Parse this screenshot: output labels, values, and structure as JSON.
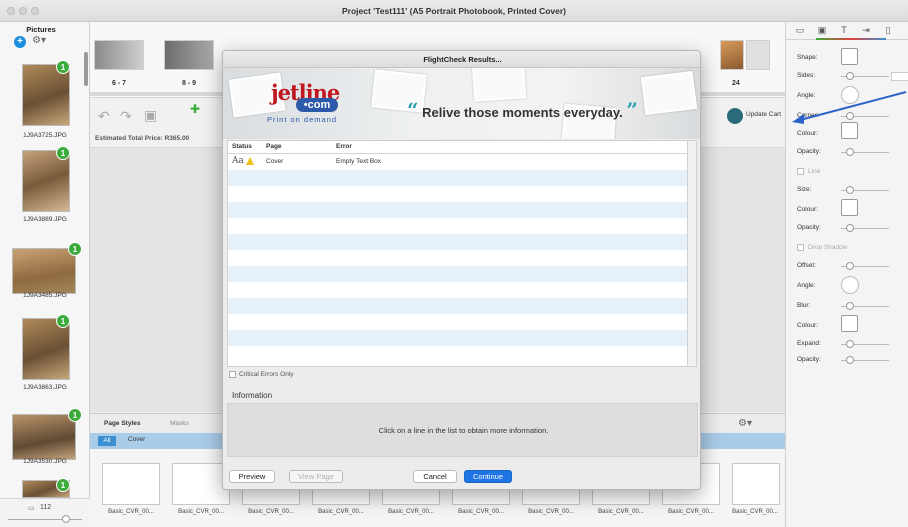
{
  "window": {
    "title": "Project 'Test111' (A5 Portrait Photobook, Printed Cover)"
  },
  "pictures_panel": {
    "title": "Pictures",
    "photos": [
      {
        "filename": "1J9A3725.JPG",
        "count": "1"
      },
      {
        "filename": "1J9A3889.JPG",
        "count": "1"
      },
      {
        "filename": "1J9A3485.JPG",
        "count": "1"
      },
      {
        "filename": "1J9A3863.JPG",
        "count": "1"
      },
      {
        "filename": "1J9A3530.JPG",
        "count": "1"
      },
      {
        "filename": "",
        "count": "1"
      }
    ],
    "footer_count": "112"
  },
  "page_strip": {
    "labels": [
      "6 - 7",
      "8 - 9",
      "24"
    ]
  },
  "toolbar": {
    "estimated_price": "Estimated Total Price: R365.00",
    "update_cart": "Update Cart"
  },
  "bottom_panel": {
    "tabs": [
      "Page Styles",
      "Masks"
    ],
    "filters": {
      "all": "All",
      "cover": "Cover"
    },
    "style_labels": [
      "Basic_CVR_00...",
      "Basic_CVR_00...",
      "Basic_CVR_00...",
      "Basic_CVR_00...",
      "Basic_CVR_00...",
      "Basic_CVR_00...",
      "Basic_CVR_00...",
      "Basic_CVR_00...",
      "Basic_CVR_00...",
      "Basic_CVR_00..."
    ]
  },
  "inspector": {
    "labels": {
      "shape": "Shape:",
      "sides": "Sides:",
      "angle": "Angle:",
      "corner": "Corner:",
      "colour": "Colour:",
      "opacity": "Opacity:",
      "line": "Line",
      "size": "Size:",
      "line_colour": "Colour:",
      "line_opacity": "Opacity:",
      "drop_shadow": "Drop Shadow",
      "offset": "Offset:",
      "shadow_angle": "Angle:",
      "blur": "Blur:",
      "shadow_colour": "Colour:",
      "expand": "Expand:",
      "shadow_opacity": "Opacity:"
    }
  },
  "dialog": {
    "title": "FlightCheck Results...",
    "banner": {
      "logo_main": "jetline",
      "logo_com": "•com",
      "logo_sub": "Print on demand",
      "quote_open": "“",
      "tagline": "Relive those moments everyday.",
      "quote_close": "”"
    },
    "columns": {
      "status": "Status",
      "page": "Page",
      "error": "Error"
    },
    "rows": [
      {
        "status_glyph": "Aa",
        "page": "Cover",
        "error": "Empty Text Box"
      }
    ],
    "critical_only_label": "Critical Errors Only",
    "information_title": "Information",
    "information_text": "Click on a line in the list to obtain more information.",
    "buttons": {
      "preview": "Preview",
      "view_page": "View Page",
      "cancel": "Cancel",
      "continue": "Continue"
    }
  },
  "colors": {
    "accent": "#1d74e2",
    "badge": "#3cab3c",
    "logo_red": "#c0161f",
    "logo_blue": "#2c59a8",
    "quote": "#2aa0b4",
    "row_alt": "#e6f0f8",
    "filter_bar": "#a9cce9"
  }
}
